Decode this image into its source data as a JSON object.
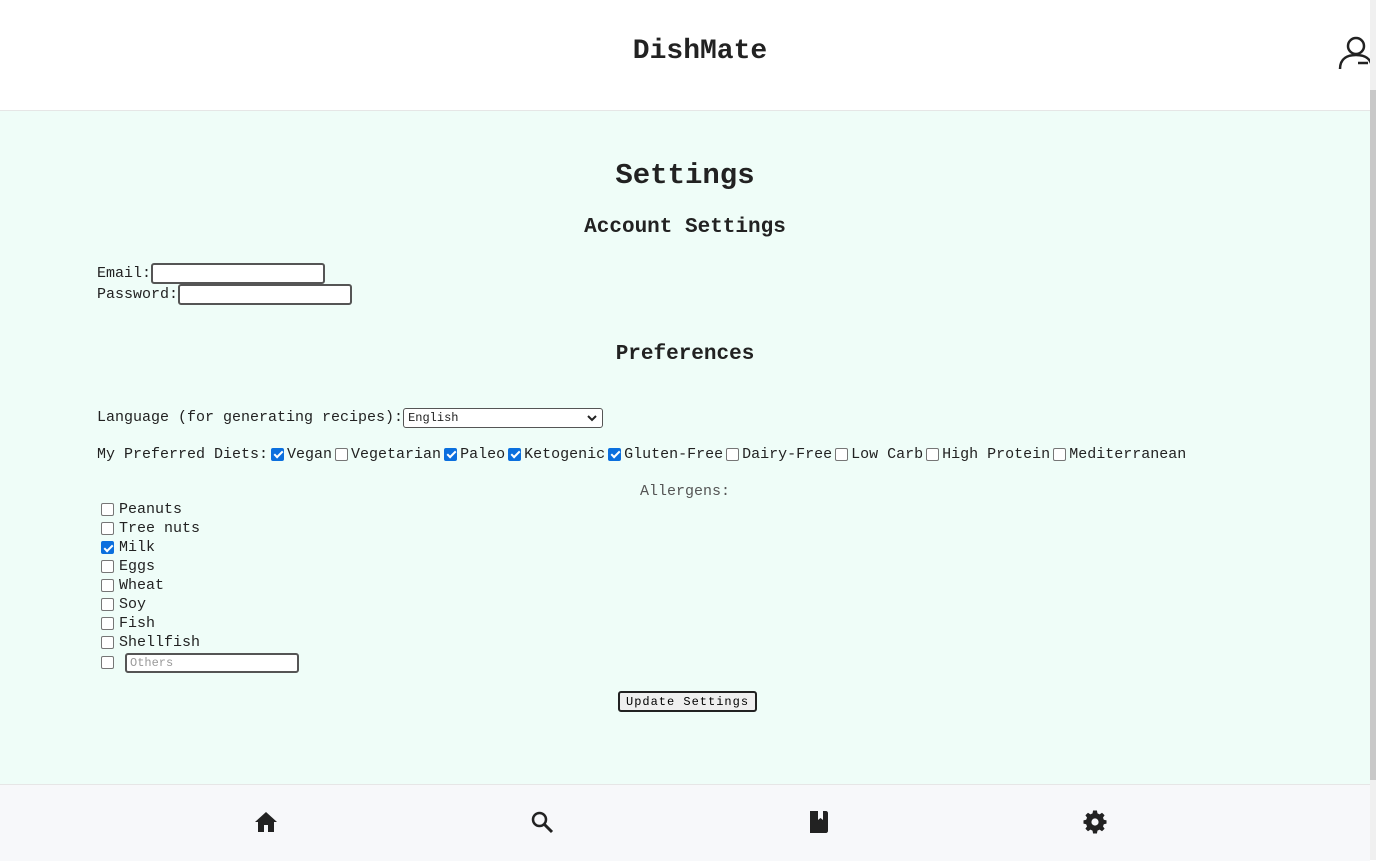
{
  "header": {
    "app_title": "DishMate"
  },
  "main": {
    "page_title": "Settings",
    "account": {
      "title": "Account Settings",
      "email_label": "Email:",
      "email_value": "",
      "password_label": "Password:",
      "password_value": ""
    },
    "preferences": {
      "title": "Preferences",
      "language_label": "Language (for generating recipes):",
      "language_selected": "English",
      "diets_label": "My Preferred Diets:",
      "diets": [
        {
          "label": "Vegan",
          "checked": true
        },
        {
          "label": "Vegetarian",
          "checked": false
        },
        {
          "label": "Paleo",
          "checked": true
        },
        {
          "label": "Ketogenic",
          "checked": true
        },
        {
          "label": "Gluten-Free",
          "checked": true
        },
        {
          "label": "Dairy-Free",
          "checked": false
        },
        {
          "label": "Low Carb",
          "checked": false
        },
        {
          "label": "High Protein",
          "checked": false
        },
        {
          "label": "Mediterranean",
          "checked": false
        }
      ],
      "allergens_label": "Allergens:",
      "allergens": [
        {
          "label": "Peanuts",
          "checked": false
        },
        {
          "label": "Tree nuts",
          "checked": false
        },
        {
          "label": "Milk",
          "checked": true
        },
        {
          "label": "Eggs",
          "checked": false
        },
        {
          "label": "Wheat",
          "checked": false
        },
        {
          "label": "Soy",
          "checked": false
        },
        {
          "label": "Fish",
          "checked": false
        },
        {
          "label": "Shellfish",
          "checked": false
        }
      ],
      "others_checked": false,
      "others_placeholder": "Others"
    },
    "update_button_label": "Update Settings"
  },
  "colors": {
    "main_background": "#effdf8",
    "checkbox_checked": "#0b6fde",
    "nav_background": "#f7f8fa"
  },
  "bottom_nav": [
    {
      "icon": "home-icon"
    },
    {
      "icon": "search-icon"
    },
    {
      "icon": "book-icon"
    },
    {
      "icon": "gear-icon"
    }
  ]
}
